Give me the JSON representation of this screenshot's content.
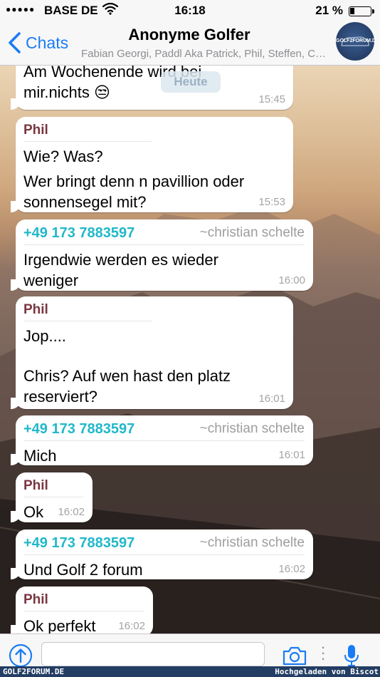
{
  "status_bar": {
    "signal": "●●●●●",
    "carrier": "BASE DE",
    "time": "16:18",
    "battery_percent": "21 %",
    "battery_level": 0.21
  },
  "nav": {
    "back_label": "Chats",
    "title": "Anonyme Golfer",
    "members": "Fabian Georgi, Paddl Aka Patrick, Phil, Steffen, Chris",
    "avatar_text": "GOLF2FORUM.DE"
  },
  "date_badge": "Heute",
  "messages": [
    {
      "lines": [
        "Am Wochenende wird bei",
        "mir.nichts 😒"
      ],
      "time": "15:45"
    },
    {
      "sender": "Phil",
      "lines": [
        "Wie? Was?",
        "Wer bringt denn n pavillion oder",
        "sonnensegel mit?"
      ],
      "time": "15:53"
    },
    {
      "sender": "+49 173 7883597",
      "alias": "~christian schelte",
      "lines": [
        "Irgendwie werden es wieder",
        "weniger"
      ],
      "time": "16:00"
    },
    {
      "sender": "Phil",
      "lines": [
        "Jop....",
        "Chris?  Auf wen hast den platz",
        "reserviert?"
      ],
      "time": "16:01"
    },
    {
      "sender": "+49 173 7883597",
      "alias": "~christian schelte",
      "lines": [
        "Mich"
      ],
      "time": "16:01"
    },
    {
      "sender": "Phil",
      "lines": [
        "Ok"
      ],
      "time": "16:02"
    },
    {
      "sender": "+49 173 7883597",
      "alias": "~christian schelte",
      "lines": [
        "Und Golf 2 forum"
      ],
      "time": "16:02"
    },
    {
      "sender": "Phil",
      "lines": [
        "Ok perfekt"
      ],
      "time": "16:02"
    }
  ],
  "input": {
    "value": "",
    "placeholder": ""
  },
  "icons": {
    "attach": "share-arrow-icon",
    "camera": "camera-icon",
    "more": "more-dots-icon",
    "mic": "microphone-icon",
    "back": "chevron-left-icon",
    "wifi": "wifi-icon"
  },
  "colors": {
    "accent": "#1a7cf5",
    "phil_name": "#7a3640",
    "phone_name": "#21b8c9"
  },
  "watermark": {
    "left": "GOLF2FORUM.DE",
    "right": "Hochgeladen von Biscot"
  }
}
